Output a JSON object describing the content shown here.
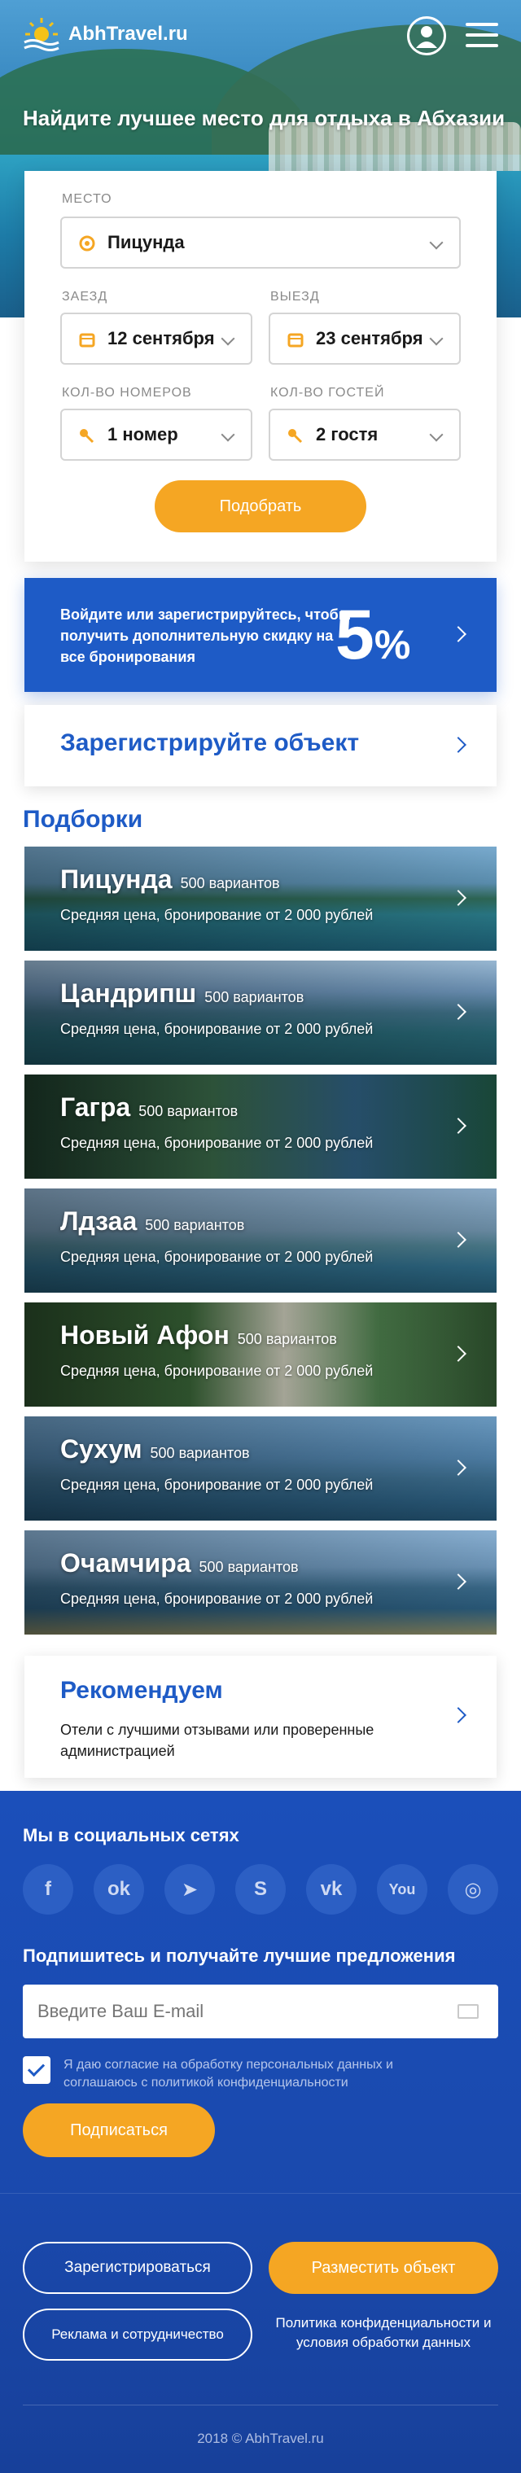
{
  "header": {
    "logo_text": "AbhTravel.ru"
  },
  "hero": {
    "title": "Найдите лучшее место для отдыха в Абхазии"
  },
  "search": {
    "place_label": "МЕСТО",
    "place_value": "Пицунда",
    "checkin_label": "ЗАЕЗД",
    "checkin_value": "12 сентября",
    "checkout_label": "ВЫЕЗД",
    "checkout_value": "23 сентября",
    "rooms_label": "КОЛ-ВО НОМЕРОВ",
    "rooms_value": "1 номер",
    "guests_label": "КОЛ-ВО ГОСТЕЙ",
    "guests_value": "2 гостя",
    "submit_label": "Подобрать"
  },
  "promo": {
    "text": "Войдите или зарегистрируйтесь, чтобы получить дополнительную скидку на все бронирования",
    "percent": "5",
    "percent_sign": "%"
  },
  "register_object": {
    "label": "Зарегистрируйте объект"
  },
  "collections": {
    "title": "Подборки",
    "items": [
      {
        "name": "Пицунда",
        "count": "500 вариантов",
        "sub": "Средняя цена, бронирование от 2 000 рублей"
      },
      {
        "name": "Цандрипш",
        "count": "500 вариантов",
        "sub": "Средняя цена, бронирование от 2 000 рублей"
      },
      {
        "name": "Гагра",
        "count": "500 вариантов",
        "sub": "Средняя цена, бронирование от 2 000 рублей"
      },
      {
        "name": "Лдзаа",
        "count": "500 вариантов",
        "sub": "Средняя цена, бронирование от 2 000 рублей"
      },
      {
        "name": "Новый Афон",
        "count": "500 вариантов",
        "sub": "Средняя цена, бронирование от 2 000 рублей"
      },
      {
        "name": "Сухум",
        "count": "500 вариантов",
        "sub": "Средняя цена, бронирование от 2 000 рублей"
      },
      {
        "name": "Очамчира",
        "count": "500 вариантов",
        "sub": "Средняя цена, бронирование от 2 000 рублей"
      }
    ]
  },
  "recommend": {
    "title": "Рекомендуем",
    "text": "Отели с лучшими отзывами или проверенные администрацией"
  },
  "footer": {
    "social_title": "Мы в социальных сетях",
    "social": [
      {
        "icon": "facebook-icon",
        "glyph": "f"
      },
      {
        "icon": "odnoklassniki-icon",
        "glyph": "ok"
      },
      {
        "icon": "telegram-icon",
        "glyph": "➤"
      },
      {
        "icon": "skype-icon",
        "glyph": "S"
      },
      {
        "icon": "vk-icon",
        "glyph": "vk"
      },
      {
        "icon": "youtube-icon",
        "glyph": "You"
      },
      {
        "icon": "instagram-icon",
        "glyph": "◎"
      }
    ],
    "subscribe_title": "Подпишитесь и получайте лучшие предложения",
    "email_placeholder": "Введите Ваш E-mail",
    "consent": "Я даю согласие на обработку персональных данных и соглашаюсь с политикой конфиденциальности",
    "subscribe_button": "Подписаться",
    "register_button": "Зарегистрироваться",
    "place_button": "Разместить объект",
    "ads_button": "Реклама и сотрудничество",
    "policy": "Политика конфиденциальности и условия обработки данных",
    "copyright": "2018 © AbhTravel.ru"
  },
  "colors": {
    "brand_blue": "#1e5bc6",
    "accent_orange": "#f5a623",
    "footer_blue": "#1b4fba"
  }
}
